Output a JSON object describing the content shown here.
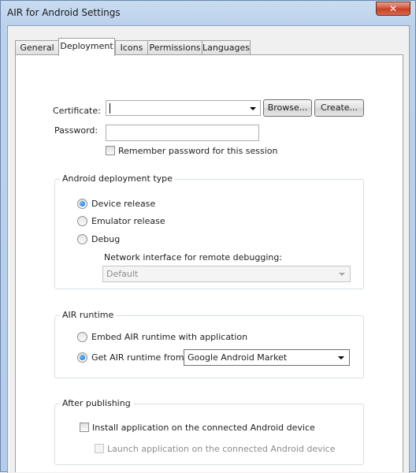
{
  "window": {
    "title": "AIR for Android Settings",
    "close_label": "✕"
  },
  "tabs": [
    {
      "label": "General"
    },
    {
      "label": "Deployment"
    },
    {
      "label": "Icons"
    },
    {
      "label": "Permissions"
    },
    {
      "label": "Languages"
    }
  ],
  "certificate": {
    "label": "Certificate:",
    "value": "",
    "browse_label": "Browse...",
    "create_label": "Create..."
  },
  "password": {
    "label": "Password:",
    "value": "",
    "remember_label": "Remember password for this session",
    "remember_checked": false
  },
  "deployment_type": {
    "title": "Android deployment type",
    "options": [
      {
        "label": "Device release",
        "checked": true
      },
      {
        "label": "Emulator release",
        "checked": false
      },
      {
        "label": "Debug",
        "checked": false
      }
    ],
    "network_label": "Network interface for remote debugging:",
    "network_value": "Default"
  },
  "air_runtime": {
    "title": "AIR runtime",
    "embed_label": "Embed AIR runtime with application",
    "get_label": "Get AIR runtime from:",
    "selected_option": "get",
    "source_value": "Google Android Market"
  },
  "after_publishing": {
    "title": "After publishing",
    "install_label": "Install application on the connected Android device",
    "install_checked": false,
    "launch_label": "Launch application on the connected Android device",
    "launch_checked": false
  }
}
